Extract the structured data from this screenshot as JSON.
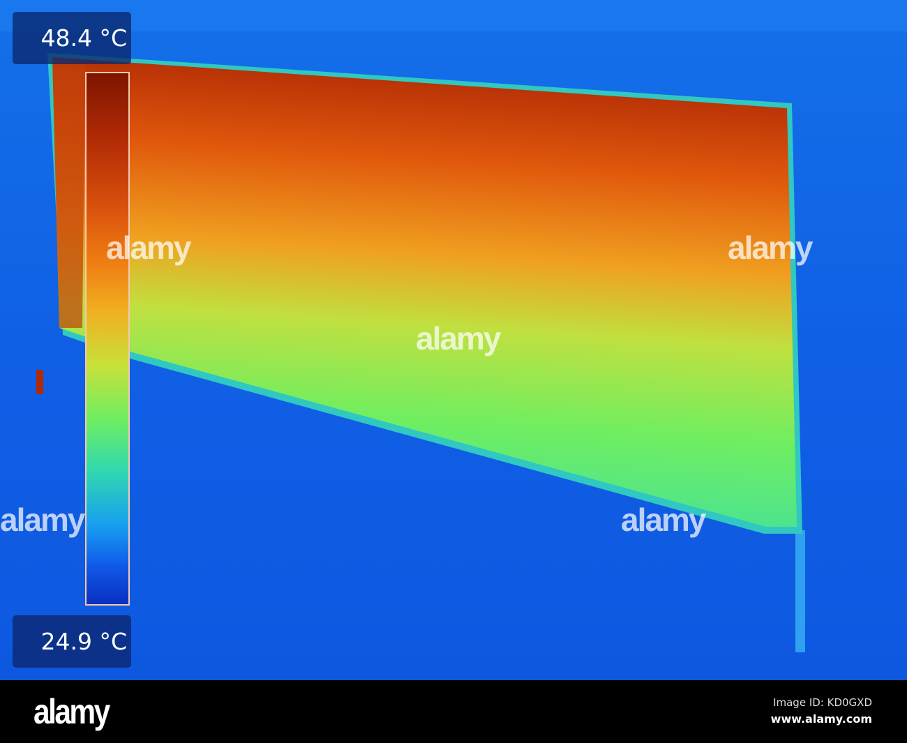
{
  "thermal_image": {
    "max_temp": "48.4 °C",
    "min_temp": "24.9 °C",
    "palette": [
      "#7e1500",
      "#d8500c",
      "#f0b020",
      "#70ee60",
      "#18a0f0",
      "#0a2fc0"
    ],
    "background_color": "#1262e6"
  },
  "watermark": {
    "text": "alamy"
  },
  "footer": {
    "logo": "alamy",
    "image_id": "Image ID: KD0GXD",
    "website": "www.alamy.com"
  }
}
